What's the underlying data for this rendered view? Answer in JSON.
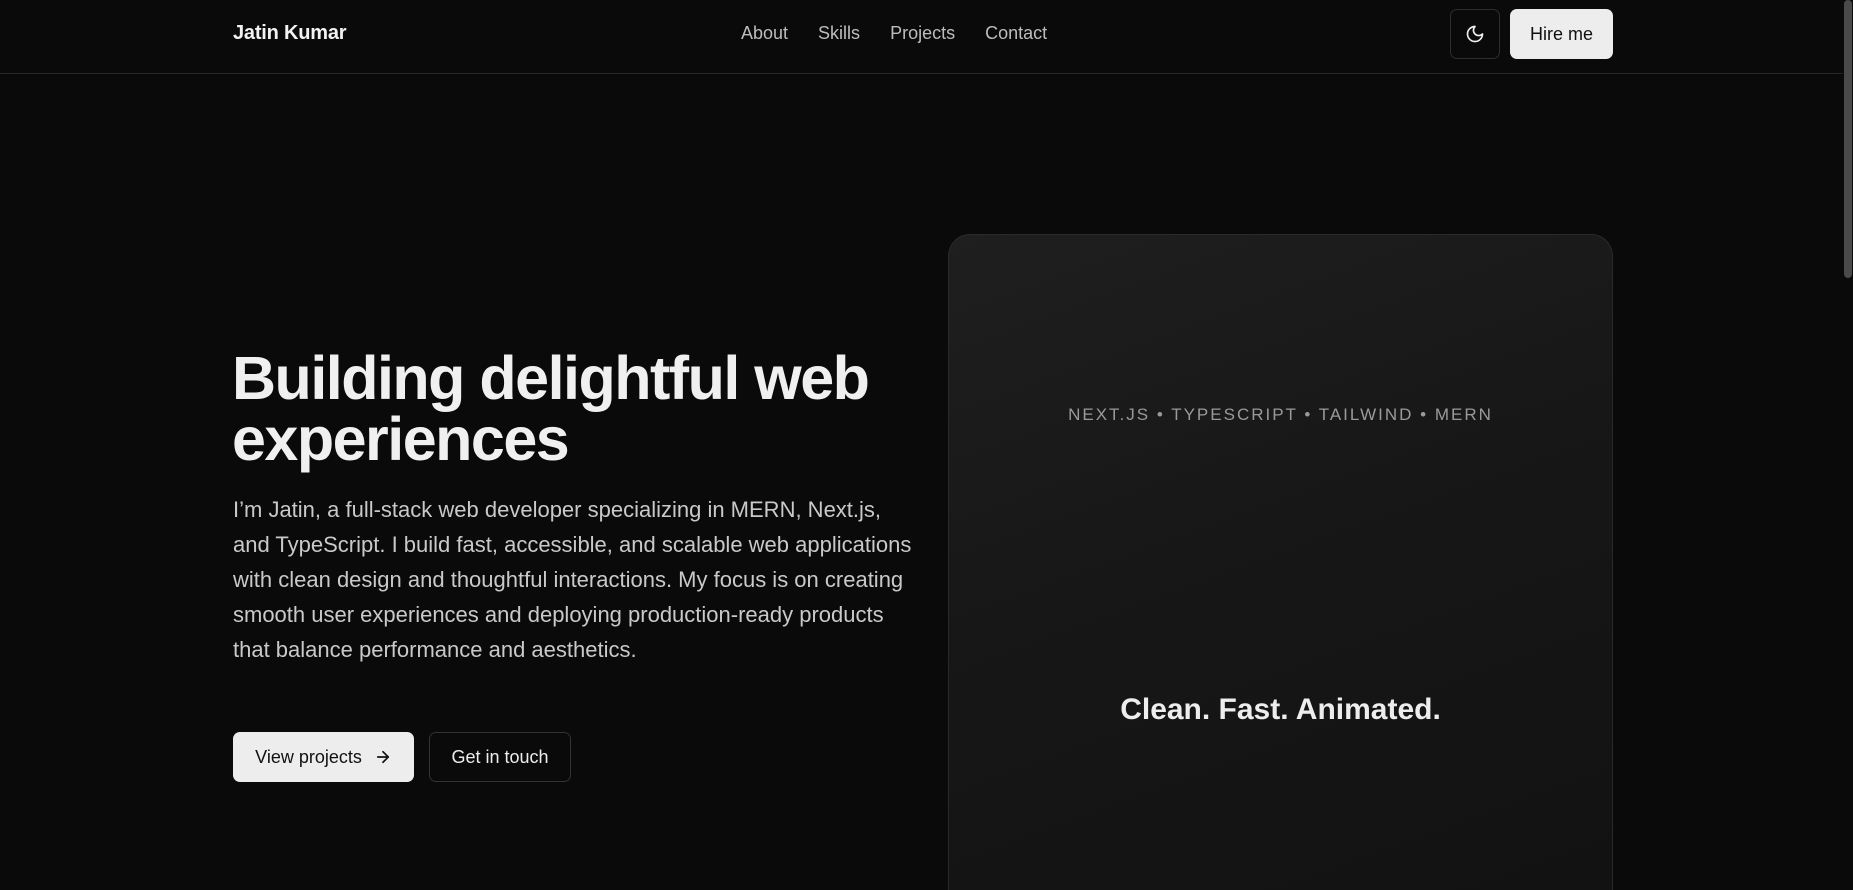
{
  "header": {
    "brand": "Jatin Kumar",
    "nav": [
      "About",
      "Skills",
      "Projects",
      "Contact"
    ],
    "theme_toggle_icon": "moon-icon",
    "hire_label": "Hire me"
  },
  "hero": {
    "title": "Building delightful web experiences",
    "description": "I’m Jatin, a full-stack web developer specializing in MERN, Next.js, and TypeScript. I build fast, accessible, and scalable web applications with clean design and thoughtful interactions. My focus is on creating smooth user experiences and deploying production-ready products that balance performance and aesthetics.",
    "primary_button": "View projects",
    "primary_button_icon": "arrow-right-icon",
    "secondary_button": "Get in touch"
  },
  "card": {
    "tags": "NEXT.JS • TYPESCRIPT • TAILWIND • MERN",
    "tagline": "Clean. Fast. Animated."
  },
  "colors": {
    "background": "#0a0a0a",
    "text": "#ededed",
    "muted": "#c9c9c9",
    "button_light": "#ededed"
  }
}
